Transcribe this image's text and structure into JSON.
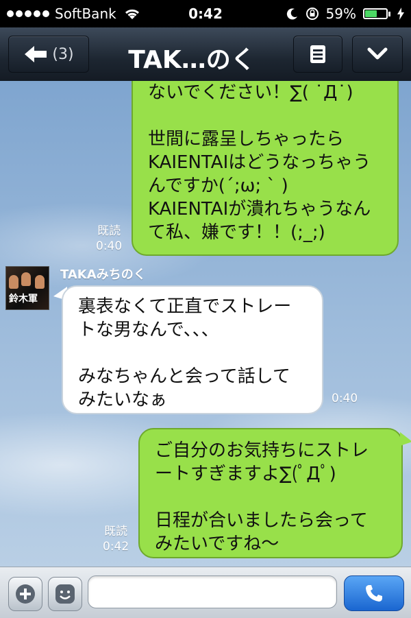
{
  "status_bar": {
    "carrier": "SoftBank",
    "time": "0:42",
    "battery_percent": "59%",
    "battery_level": 0.59
  },
  "nav": {
    "back_count": "(3)",
    "title": "TAK…のく"
  },
  "messages": [
    {
      "from": "me",
      "text": "ないでください！∑( ˙Д˙)\n\n世間に露呈しちゃったら\nKAIENTAIはどうなっちゃう\nんですか(´;ω; ` )\nKAIENTAIが潰れちゃうなん\nて私、嫌です！！(;_;)",
      "read": "既読",
      "time": "0:40"
    },
    {
      "from": "other",
      "sender": "TAKAみちのく",
      "text": "裏表なくて正直でストレー\nトな男なんで、、、\n\nみなちゃんと会って話して\nみたいなぁ",
      "time": "0:40"
    },
    {
      "from": "me",
      "text": "ご自分のお気持ちにストレ\nートすぎますよ∑(ﾟДﾟ)\n\n日程が合いましたら会って\nみたいですね〜",
      "read": "既読",
      "time": "0:42"
    }
  ],
  "avatar_logo_text": "鈴木軍",
  "input": {
    "placeholder": ""
  },
  "colors": {
    "my_bubble": "#98e04a",
    "their_bubble": "#ffffff",
    "call_button": "#1a66d0"
  },
  "icons": [
    "wifi-icon",
    "moon-icon",
    "rotation-lock-icon",
    "battery-icon",
    "charging-icon",
    "back-arrow-icon",
    "menu-icon",
    "chevron-down-icon",
    "plus-icon",
    "emoji-icon",
    "phone-icon"
  ]
}
